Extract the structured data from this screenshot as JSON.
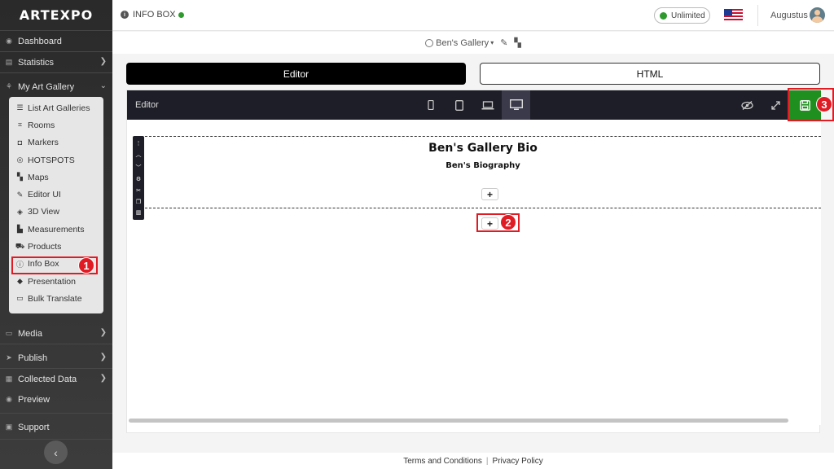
{
  "app": {
    "logo": "ARTEXPO"
  },
  "sidebar": {
    "items": [
      {
        "label": "Dashboard",
        "icon": "dashboard-icon"
      },
      {
        "label": "Statistics",
        "icon": "statistics-icon",
        "chevron": "right"
      },
      {
        "label": "My Art Gallery",
        "icon": "gallery-icon",
        "chevron": "down"
      },
      {
        "label": "Media",
        "icon": "media-icon",
        "chevron": "right"
      },
      {
        "label": "Publish",
        "icon": "publish-icon",
        "chevron": "right"
      },
      {
        "label": "Collected Data",
        "icon": "collected-data-icon",
        "chevron": "right"
      },
      {
        "label": "Preview",
        "icon": "preview-icon"
      },
      {
        "label": "Support",
        "icon": "support-icon"
      }
    ],
    "submenu": [
      {
        "label": "List Art Galleries",
        "icon": "list-icon"
      },
      {
        "label": "Rooms",
        "icon": "rooms-icon"
      },
      {
        "label": "Markers",
        "icon": "markers-icon"
      },
      {
        "label": "HOTSPOTS",
        "icon": "hotspot-icon"
      },
      {
        "label": "Maps",
        "icon": "map-icon"
      },
      {
        "label": "Editor UI",
        "icon": "editor-ui-icon"
      },
      {
        "label": "3D View",
        "icon": "cube-icon"
      },
      {
        "label": "Measurements",
        "icon": "measurements-icon"
      },
      {
        "label": "Products",
        "icon": "cart-icon"
      },
      {
        "label": "Info Box",
        "icon": "info-icon",
        "active": true
      },
      {
        "label": "Presentation",
        "icon": "presentation-icon"
      },
      {
        "label": "Bulk Translate",
        "icon": "translate-icon"
      }
    ]
  },
  "header": {
    "page_title": "INFO BOX",
    "plan": "Unlimited",
    "language_flag": "us-flag-icon",
    "user_name": "Augustus"
  },
  "gallery_bar": {
    "gallery_name": "Ben's Gallery"
  },
  "view_tabs": {
    "editor": "Editor",
    "html": "HTML"
  },
  "editor": {
    "label": "Editor",
    "devices": [
      "mobile-icon",
      "tablet-icon",
      "laptop-icon",
      "desktop-icon"
    ],
    "active_device": "desktop-icon",
    "content": {
      "title": "Ben's Gallery Bio",
      "subtitle": "Ben's Biography"
    }
  },
  "annotations": {
    "step1": "1",
    "step2": "2",
    "step3": "3"
  },
  "footer": {
    "terms": "Terms and Conditions",
    "privacy": "Privacy Policy"
  },
  "colors": {
    "save_green": "#1f8f1f",
    "annotation_red": "#e01b24",
    "status_green": "#2e9a2e"
  }
}
